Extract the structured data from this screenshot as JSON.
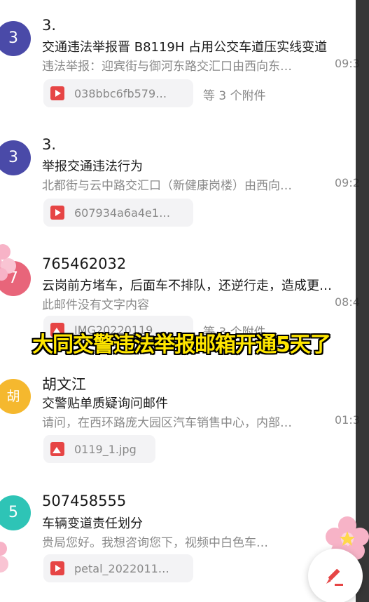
{
  "caption": "大同交警违法举报邮箱开通5天了",
  "mails": [
    {
      "avatar_text": "3",
      "avatar_color": "#4a4aa8",
      "sender": "3.",
      "subject": "交通违法举报晋 B8119H 占用公交车道压实线变道",
      "preview": "违法举报：迎宾街与御河东路交汇口由西向东…",
      "time": "09:3",
      "attachment": {
        "name": "038bbc6fb579…",
        "type": "video"
      },
      "extra": "等 3 个附件"
    },
    {
      "avatar_text": "3",
      "avatar_color": "#4a4aa8",
      "sender": "3.",
      "subject": "举报交通违法行为",
      "preview": "北都街与云中路交汇口（新健康岗楼）由西向…",
      "time": "09:2",
      "attachment": {
        "name": "607934a6a4e1…",
        "type": "video"
      },
      "extra": ""
    },
    {
      "avatar_text": "7",
      "avatar_color": "#e8657a",
      "sender": "765462032",
      "subject": "云岗前方堵车，后面车不排队，还逆行走，造成更…",
      "preview": "此邮件没有文字内容",
      "time": "08:4",
      "attachment": {
        "name": "IMG20220119",
        "type": "image"
      },
      "extra": "等 3 个附件"
    },
    {
      "avatar_text": "胡",
      "avatar_color": "#f5b82e",
      "sender": "胡文江",
      "subject": "交警贴单质疑询问邮件",
      "preview": "请问，在西环路庞大园区汽车销售中心，内部…",
      "time": "01:3",
      "attachment": {
        "name": "0119_1.jpg",
        "type": "image"
      },
      "extra": ""
    },
    {
      "avatar_text": "5",
      "avatar_color": "#2ec4b6",
      "sender": "507458555",
      "subject": "车辆变道责任划分",
      "preview": "贵局您好。我想咨询您下，视频中白色车…",
      "time": "",
      "attachment": {
        "name": "petal_2022011…",
        "type": "video"
      },
      "extra": ""
    }
  ],
  "colors": {
    "accent": "#e64545",
    "caption": "#ffe600"
  }
}
